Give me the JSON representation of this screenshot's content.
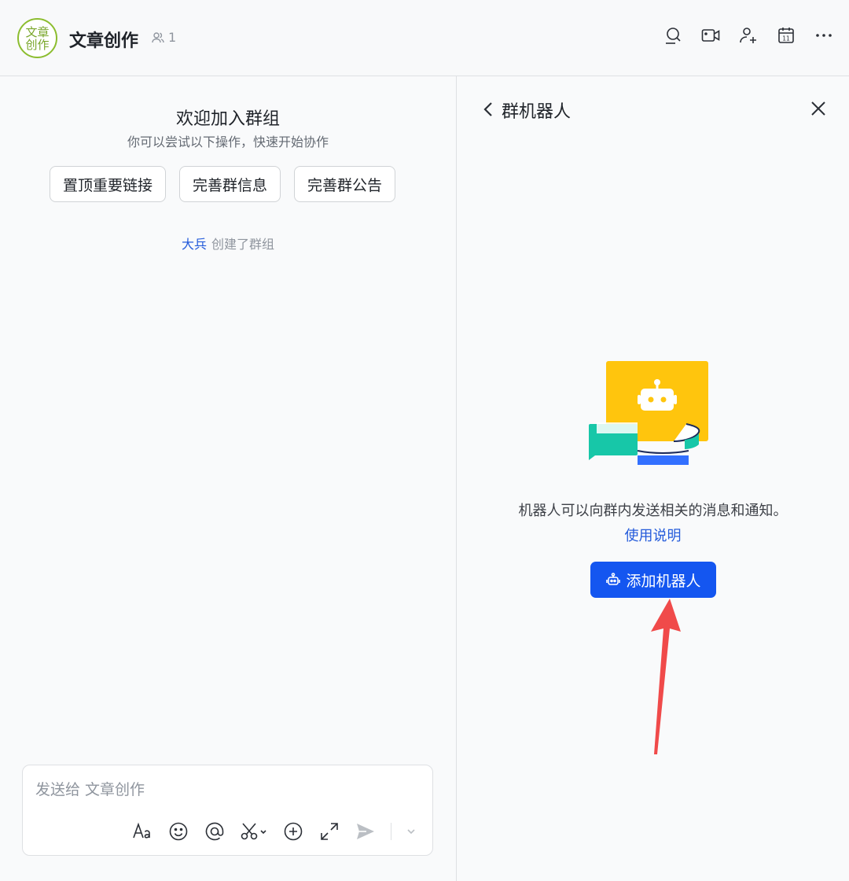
{
  "header": {
    "avatar_text": "文章创作",
    "title": "文章创作",
    "member_count": "1",
    "icons": [
      "search-icon",
      "video-icon",
      "add-member-icon",
      "calendar-icon",
      "more-icon"
    ],
    "calendar_day": "11"
  },
  "chat": {
    "welcome_title": "欢迎加入群组",
    "welcome_subtitle": "你可以尝试以下操作，快速开始协作",
    "quick_actions": [
      "置顶重要链接",
      "完善群信息",
      "完善群公告"
    ],
    "system_message": {
      "user": "大兵",
      "text": "创建了群组"
    },
    "composer": {
      "placeholder": "发送给 文章创作",
      "tools": [
        "text-format-icon",
        "emoji-icon",
        "mention-icon",
        "scissors-icon",
        "plus-circle-icon",
        "expand-icon",
        "send-icon",
        "chevron-down-icon"
      ]
    }
  },
  "panel": {
    "title": "群机器人",
    "description": "机器人可以向群内发送相关的消息和通知。",
    "usage_link": "使用说明",
    "add_button": "添加机器人"
  },
  "colors": {
    "accent": "#1456f0",
    "link": "#245bdb",
    "avatar_green": "#8cbd2f",
    "arrow_red": "#f04a4a"
  }
}
